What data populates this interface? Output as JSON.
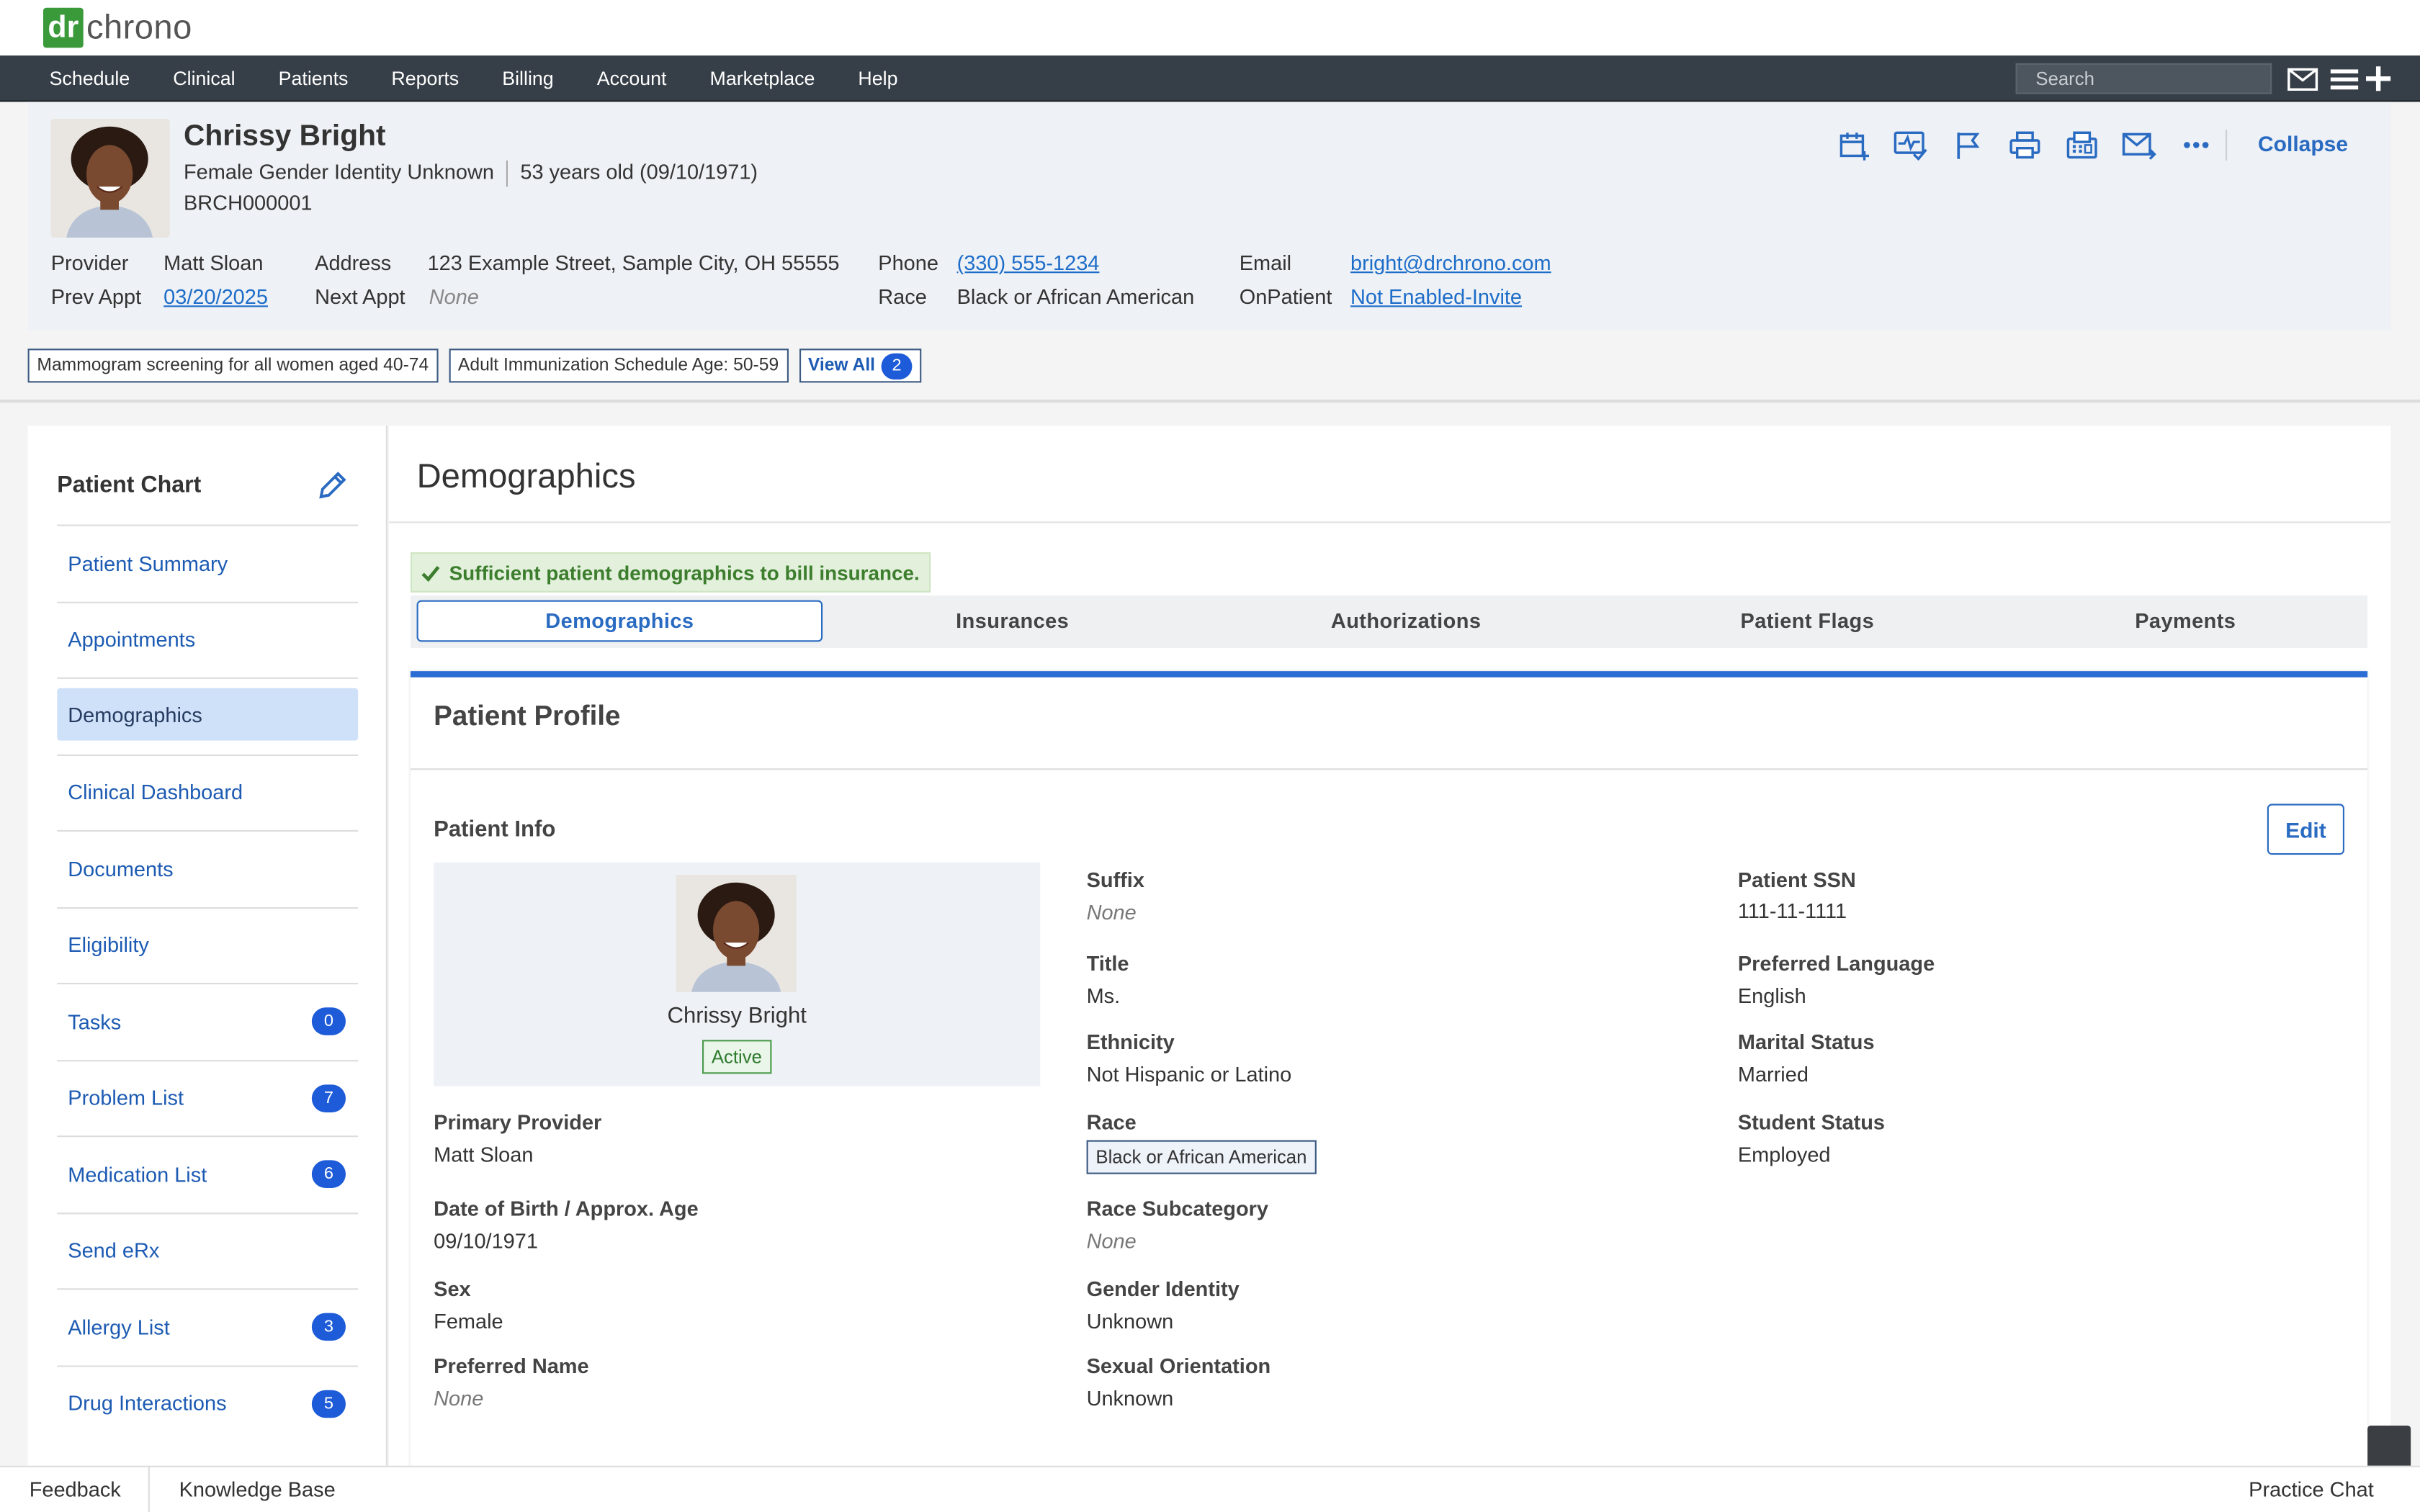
{
  "brand": {
    "logo_part1": "dr",
    "logo_part2": "chrono"
  },
  "nav": {
    "items": [
      "Schedule",
      "Clinical",
      "Patients",
      "Reports",
      "Billing",
      "Account",
      "Marketplace",
      "Help"
    ],
    "search_placeholder": "Search"
  },
  "patient": {
    "name": "Chrissy Bright",
    "gender_line": "Female Gender Identity Unknown",
    "age_line": "53 years old (09/10/1971)",
    "chart_id": "BRCH000001",
    "provider_label": "Provider",
    "provider": "Matt Sloan",
    "address_label": "Address",
    "address": "123 Example Street, Sample City, OH 55555",
    "phone_label": "Phone",
    "phone": "(330) 555-1234",
    "email_label": "Email",
    "email": "bright@drchrono.com",
    "prev_appt_label": "Prev Appt",
    "prev_appt": "03/20/2025",
    "next_appt_label": "Next Appt",
    "next_appt": "None",
    "race_label": "Race",
    "race": "Black or African American",
    "onpatient_label": "OnPatient",
    "onpatient": "Not Enabled-Invite",
    "collapse_label": "Collapse"
  },
  "alerts": {
    "items": [
      "Mammogram screening for all women aged 40-74",
      "Adult Immunization Schedule Age: 50-59"
    ],
    "view_all_label": "View All",
    "view_all_count": "2"
  },
  "sidebar": {
    "title": "Patient Chart",
    "items": [
      {
        "label": "Patient Summary",
        "badge": ""
      },
      {
        "label": "Appointments",
        "badge": ""
      },
      {
        "label": "Demographics",
        "badge": "",
        "active": true
      },
      {
        "label": "Clinical Dashboard",
        "badge": ""
      },
      {
        "label": "Documents",
        "badge": ""
      },
      {
        "label": "Eligibility",
        "badge": ""
      },
      {
        "label": "Tasks",
        "badge": "0"
      },
      {
        "label": "Problem List",
        "badge": "7"
      },
      {
        "label": "Medication List",
        "badge": "6"
      },
      {
        "label": "Send eRx",
        "badge": ""
      },
      {
        "label": "Allergy List",
        "badge": "3"
      },
      {
        "label": "Drug Interactions",
        "badge": "5"
      }
    ]
  },
  "main": {
    "title": "Demographics",
    "banner": "Sufficient patient demographics to bill insurance.",
    "tabs": [
      "Demographics",
      "Insurances",
      "Authorizations",
      "Patient Flags",
      "Payments"
    ],
    "active_tab": "Demographics"
  },
  "profile": {
    "title": "Patient Profile",
    "info_title": "Patient Info",
    "edit_label": "Edit",
    "card_name": "Chrissy Bright",
    "card_status": "Active",
    "left": [
      {
        "label": "Primary Provider",
        "value": "Matt Sloan"
      },
      {
        "label": "Date of Birth / Approx. Age",
        "value": "09/10/1971"
      },
      {
        "label": "Sex",
        "value": "Female"
      },
      {
        "label": "Preferred Name",
        "value": "None"
      }
    ],
    "middle": [
      {
        "label": "Suffix",
        "value": "None"
      },
      {
        "label": "Title",
        "value": "Ms."
      },
      {
        "label": "Ethnicity",
        "value": "Not Hispanic or Latino"
      },
      {
        "label": "Race",
        "value": "Black or African American"
      },
      {
        "label": "Race Subcategory",
        "value": "None"
      },
      {
        "label": "Gender Identity",
        "value": "Unknown"
      },
      {
        "label": "Sexual Orientation",
        "value": "Unknown"
      }
    ],
    "right": [
      {
        "label": "Patient SSN",
        "value": "111-11-1111"
      },
      {
        "label": "Preferred Language",
        "value": "English"
      },
      {
        "label": "Marital Status",
        "value": "Married"
      },
      {
        "label": "Student Status",
        "value": "Employed"
      }
    ]
  },
  "footer": {
    "feedback": "Feedback",
    "knowledge_base": "Knowledge Base",
    "practice_chat": "Practice Chat"
  },
  "colors": {
    "nav_bg": "#363e47",
    "accent": "#2a6bc2",
    "badge": "#1d5bd8",
    "success": "#3d7d2e",
    "logo_green": "#3a9a3a"
  }
}
